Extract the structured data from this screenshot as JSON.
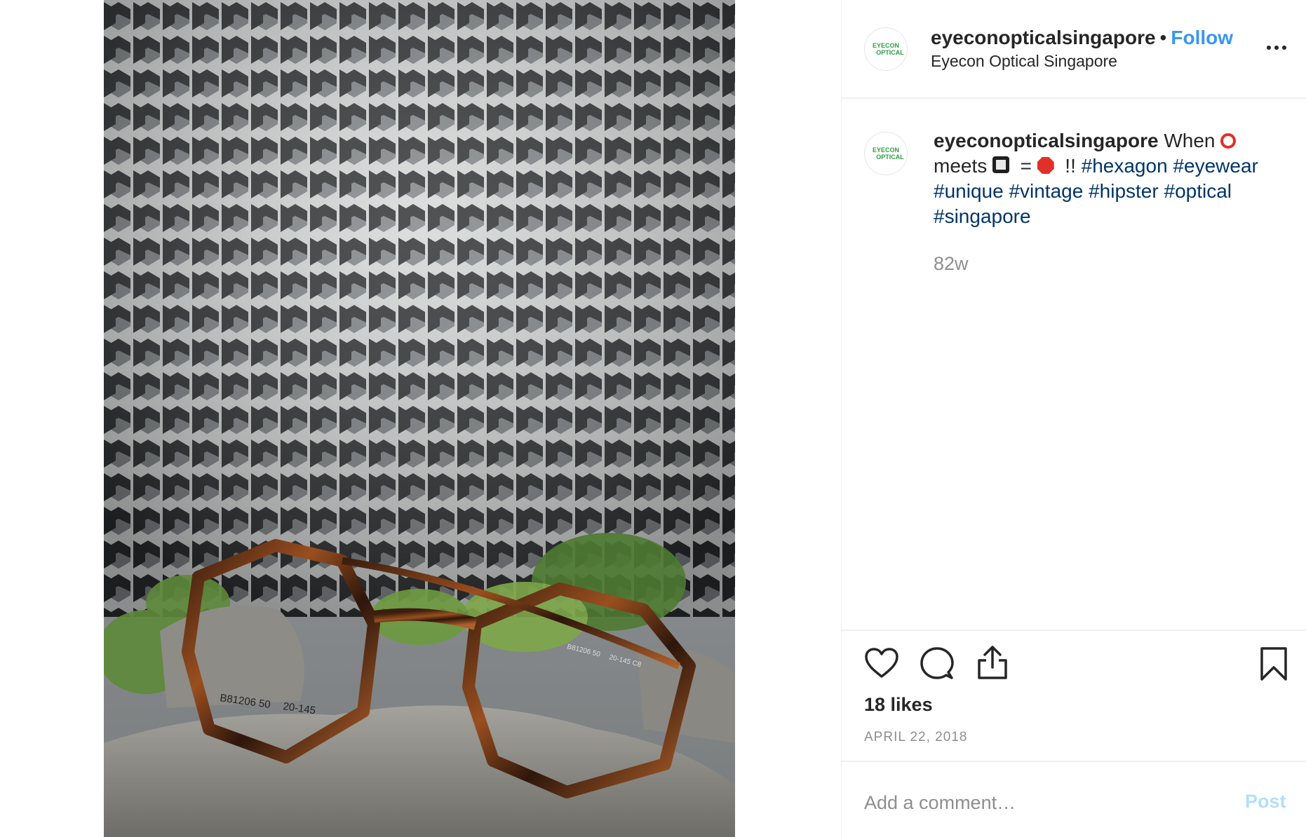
{
  "post": {
    "image_alt": "Tortoiseshell hexagon eyeglasses on a rock in front of a honeycomb-patterned building",
    "frame_print_left": "B81206  50",
    "frame_print_left_2": "20-145",
    "frame_print_right": "B81206 50",
    "frame_print_right_2": "20-145  C8"
  },
  "header": {
    "avatar_text_1": "EYECON",
    "avatar_text_2": "OPTICAL",
    "username": "eyeconopticalsingapore",
    "separator": "•",
    "follow_label": "Follow",
    "subtitle": "Eyecon Optical Singapore",
    "more_icon": "more-horizontal-icon"
  },
  "caption": {
    "username": "eyeconopticalsingapore",
    "text_1": "When",
    "text_2": "meets",
    "text_3": "=",
    "text_4": "!!",
    "emoji_1": "red-circle-emoji",
    "emoji_2": "square-emoji",
    "emoji_3": "stop-sign-emoji",
    "hashtags": [
      "#hexagon",
      "#eyewear",
      "#unique",
      "#vintage",
      "#hipster",
      "#optical",
      "#singapore"
    ],
    "age": "82w"
  },
  "actions": {
    "like_icon": "heart-icon",
    "comment_icon": "comment-icon",
    "share_icon": "share-icon",
    "save_icon": "bookmark-icon",
    "likes": "18 likes",
    "date": "APRIL 22, 2018"
  },
  "comment": {
    "placeholder": "Add a comment…",
    "post_label": "Post"
  },
  "colors": {
    "accent": "#3897f0",
    "hashtag": "#003569",
    "muted": "#8e8e8e",
    "post_disabled": "#b2dffc"
  }
}
